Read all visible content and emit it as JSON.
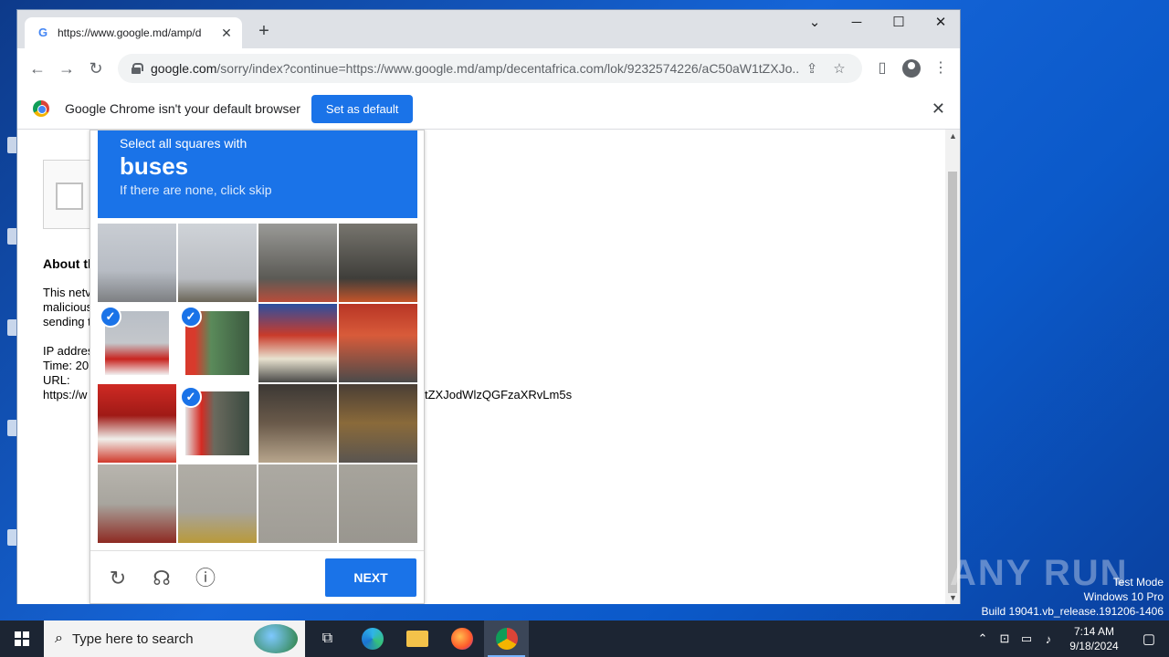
{
  "browser": {
    "tab_title": "https://www.google.md/amp/d",
    "tab_favicon": "G",
    "address_host": "google.com",
    "address_path": "/sorry/index?continue=https://www.google.md/amp/decentafrica.com/lok/9232574226/aC50aW1tZXJo...",
    "infobar_text": "Google Chrome isn't your default browser",
    "infobar_button": "Set as default"
  },
  "page": {
    "about_heading": "About th",
    "para_lines": [
      "This netv",
      "malicious",
      "sending t"
    ],
    "ip_line": "IP addres",
    "time_line": "Time: 20",
    "url_label": "URL:",
    "url_value": "https://w",
    "url_tail": "tZXJodWlzQGFzaXRvLm5s"
  },
  "captcha": {
    "instruction": "Select all squares with",
    "target": "buses",
    "hint": "If there are none, click skip",
    "next_label": "NEXT",
    "selected_tiles": [
      4,
      5,
      9
    ]
  },
  "taskbar": {
    "search_placeholder": "Type here to search",
    "time": "7:14 AM",
    "date": "9/18/2024"
  },
  "watermark": {
    "mode": "Test Mode",
    "os": "Windows 10 Pro",
    "build": "Build 19041.vb_release.191206-1406",
    "brand": "ANY RUN"
  },
  "colors": {
    "accent": "#1a73e8",
    "taskbar": "#1c2533",
    "desktop": "#1565d8"
  }
}
